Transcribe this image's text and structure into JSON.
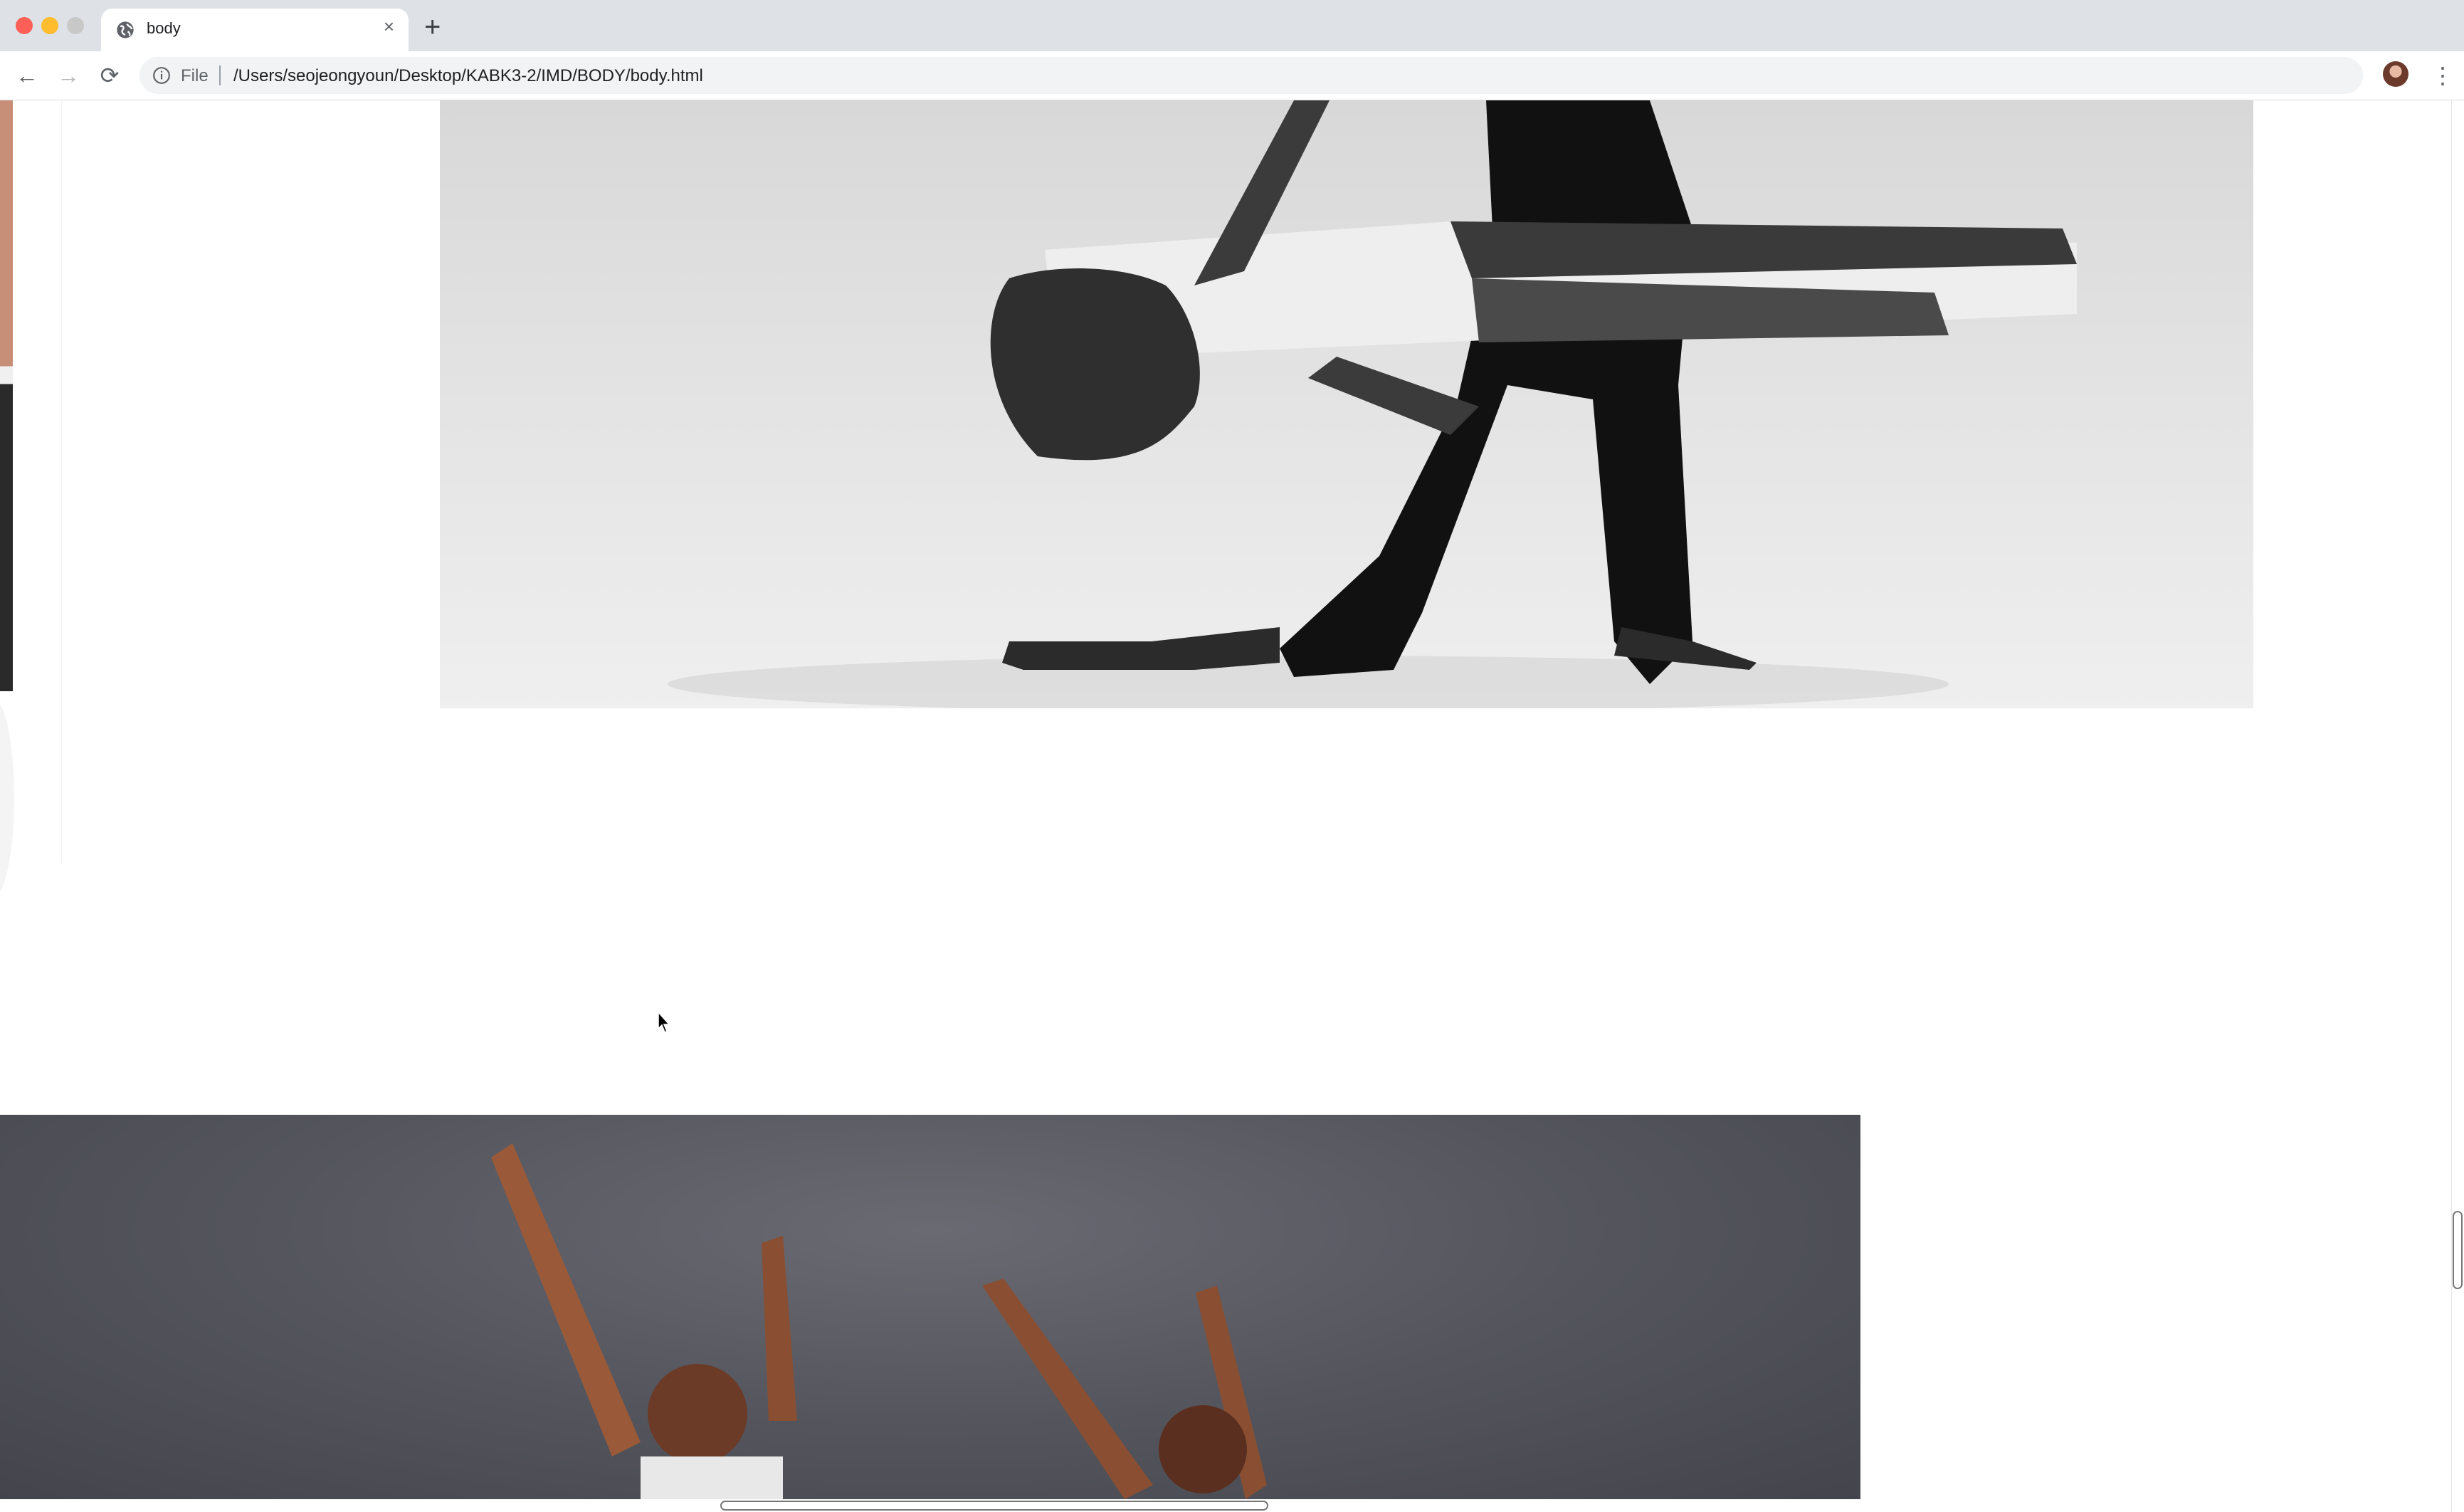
{
  "browser": {
    "tab": {
      "title": "body",
      "close_glyph": "×"
    },
    "new_tab_glyph": "+",
    "nav": {
      "back_glyph": "←",
      "forward_glyph": "→",
      "reload_glyph": "⟳"
    },
    "omnibox": {
      "scheme_label": "File",
      "url": "/Users/seojeongyoun/Desktop/KABK3-2/IMD/BODY/body.html"
    },
    "menu_glyph": "⋮",
    "traffic_colors": [
      "#ff5f57",
      "#febc2e",
      "#c8c8c8"
    ]
  },
  "page": {
    "images": [
      {
        "name": "dancer-backbend-photo",
        "description": "black and white photo of a dancer leaning backward"
      },
      {
        "name": "two-dancers-arms-raised-photo",
        "description": "color photo of two dancers with arms raised on gray backdrop"
      }
    ]
  },
  "icons": {
    "tab_favicon": "globe-icon",
    "info": "info-icon",
    "bookmark": "star-icon",
    "profile": "avatar"
  }
}
